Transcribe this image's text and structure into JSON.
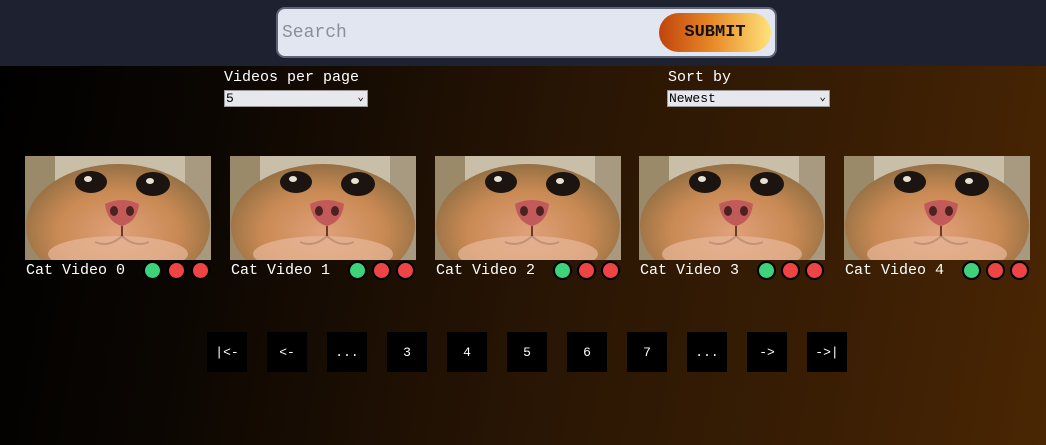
{
  "search": {
    "placeholder": "Search",
    "submit_label": "SUBMIT"
  },
  "controls": {
    "videos_per_page": {
      "label": "Videos per page",
      "selected": "5"
    },
    "sort_by": {
      "label": "Sort by",
      "selected": "Newest"
    }
  },
  "videos": [
    {
      "title": "Cat Video 0"
    },
    {
      "title": "Cat Video 1"
    },
    {
      "title": "Cat Video 2"
    },
    {
      "title": "Cat Video 3"
    },
    {
      "title": "Cat Video 4"
    }
  ],
  "pagination": [
    "|<-",
    "<-",
    "...",
    "3",
    "4",
    "5",
    "6",
    "7",
    "...",
    "->",
    "->|"
  ],
  "colors": {
    "accent_green": "#3ed37a",
    "accent_red": "#ef4444",
    "topbar": "#1e2230"
  }
}
